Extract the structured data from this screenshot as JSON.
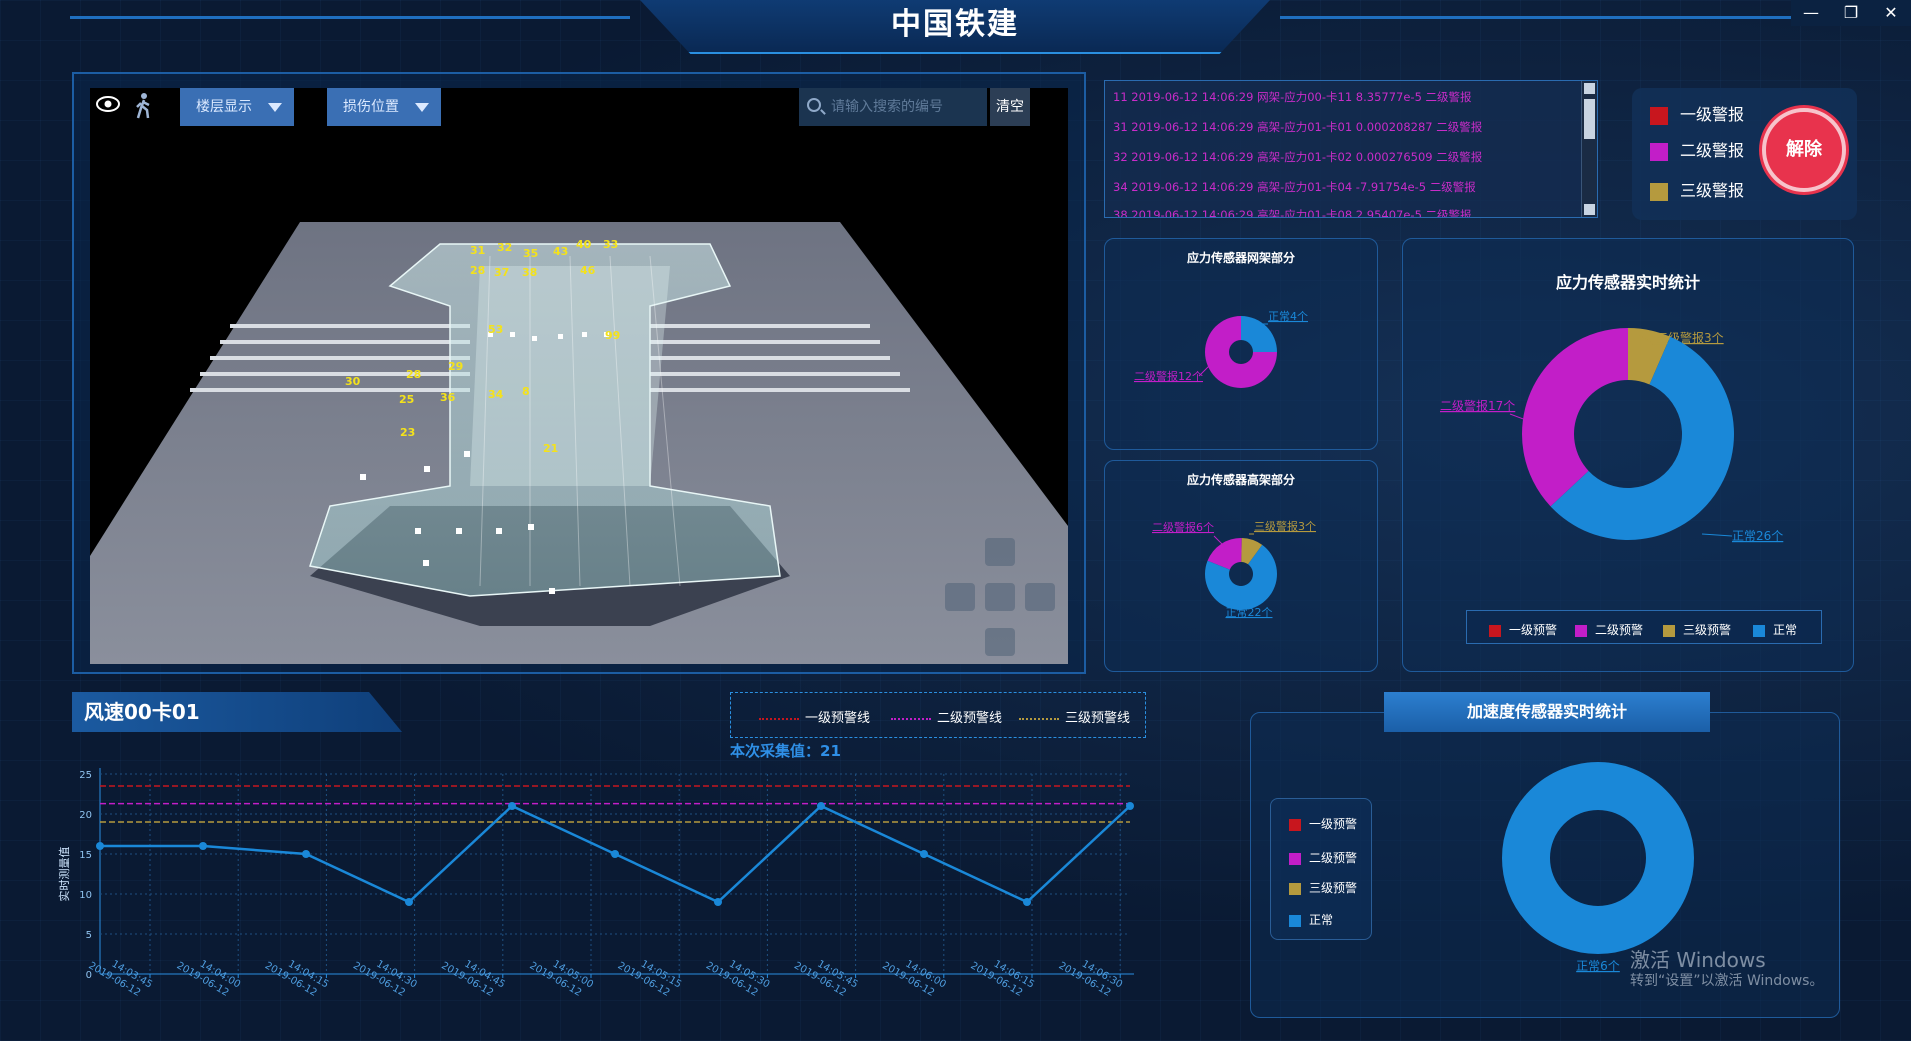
{
  "app": {
    "title": "中国铁建"
  },
  "window_controls": {
    "minimize": "—",
    "restore": "❐",
    "close": "✕"
  },
  "toolbar": {
    "floor_display": "楼层显示",
    "damage_position": "损伤位置",
    "search_placeholder": "请输入搜索的编号",
    "clear": "清空",
    "icons": [
      "eye-icon",
      "walk-icon",
      "search-icon",
      "dropdown-icon"
    ]
  },
  "markers": [
    "31",
    "32",
    "35",
    "43",
    "40",
    "33",
    "28",
    "37",
    "38",
    "46",
    "53",
    "99",
    "30",
    "28",
    "29",
    "25",
    "36",
    "34",
    "8",
    "23",
    "21"
  ],
  "alerts": {
    "rows": [
      "11  2019-06-12 14:06:29  网架-应力00-卡11  8.35777e-5      二级警报",
      "31  2019-06-12 14:06:29  高架-应力01-卡01  0.000208287     二级警报",
      "32  2019-06-12 14:06:29  高架-应力01-卡02  0.000276509     二级警报",
      "34  2019-06-12 14:06:29  高架-应力01-卡04  -7.91754e-5     二级警报",
      "38  2019-06-12 14:06:29  高架-应力01-卡08  2.95407e-5      二级警报"
    ]
  },
  "alarm_legend": {
    "level1": "一级警报",
    "level2": "二级警报",
    "level3": "三级警报",
    "release": "解除"
  },
  "colors": {
    "level1": "#c8161e",
    "level2": "#c21ec8",
    "level3": "#b59a3e",
    "normal": "#1a88d8",
    "accent": "#2a8fe0"
  },
  "panels": {
    "grid_title": "应力传感器网架部分",
    "elevated_title": "应力传感器高架部分",
    "stress_title": "应力传感器实时统计",
    "accel_title": "加速度传感器实时统计"
  },
  "chart_data": [
    {
      "type": "pie",
      "title": "应力传感器网架部分",
      "labels": [
        "正常4个",
        "二级警报12个"
      ],
      "categories": [
        "正常",
        "二级警报"
      ],
      "values": [
        4,
        12
      ]
    },
    {
      "type": "pie",
      "title": "应力传感器高架部分",
      "labels": [
        "二级警报6个",
        "三级警报3个",
        "正常22个"
      ],
      "categories": [
        "二级警报",
        "三级警报",
        "正常"
      ],
      "values": [
        6,
        3,
        22
      ]
    },
    {
      "type": "pie",
      "title": "应力传感器实时统计",
      "labels": [
        "三级警报3个",
        "二级警报17个",
        "正常26个"
      ],
      "categories": [
        "三级警报",
        "二级警报",
        "正常"
      ],
      "values": [
        3,
        17,
        26
      ],
      "legend": [
        "一级预警",
        "二级预警",
        "三级预警",
        "正常"
      ],
      "legend_position": "bottom"
    },
    {
      "type": "pie",
      "title": "加速度传感器实时统计",
      "labels": [
        "正常6个"
      ],
      "categories": [
        "正常"
      ],
      "values": [
        6
      ],
      "legend": [
        "一级预警",
        "二级预警",
        "三级预警",
        "正常"
      ],
      "legend_position": "left"
    },
    {
      "type": "line",
      "title": "风速00卡01",
      "ylabel": "实时测量值",
      "ylim": [
        0,
        25
      ],
      "yticks": [
        0,
        5,
        10,
        15,
        20,
        25
      ],
      "x": [
        "14:03:45",
        "14:04:00",
        "14:04:15",
        "14:04:30",
        "14:04:45",
        "14:05:00",
        "14:05:15",
        "14:05:30",
        "14:05:45",
        "14:06:00",
        "14:06:15",
        "14:06:30"
      ],
      "x_date": "2019-06-12",
      "series": [
        {
          "values": [
            16,
            16,
            15,
            9,
            21,
            15,
            9,
            21,
            15,
            9,
            21
          ]
        }
      ],
      "thresholds": [
        {
          "name": "一级预警线",
          "value": 23.5,
          "color": "#c8161e"
        },
        {
          "name": "二级预警线",
          "value": 21.3,
          "color": "#c21ec8"
        },
        {
          "name": "三级预警线",
          "value": 19,
          "color": "#b59a3e"
        }
      ],
      "collect_label": "本次采集值：21",
      "grid": true
    }
  ],
  "watermark": {
    "line1": "激活 Windows",
    "line2": "转到“设置”以激活 Windows。"
  }
}
